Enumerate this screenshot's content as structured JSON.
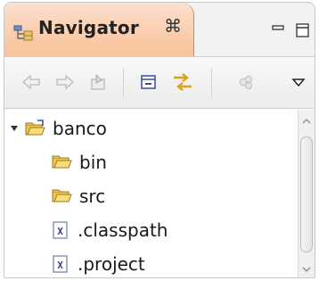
{
  "view": {
    "title": "Navigator",
    "close_glyph": "⌘",
    "tab_color": "#f9c9a6"
  },
  "toolbar": {
    "buttons": [
      {
        "name": "back-icon",
        "enabled": false
      },
      {
        "name": "forward-icon",
        "enabled": false
      },
      {
        "name": "go-into-icon",
        "enabled": false
      },
      {
        "name": "collapse-all-icon",
        "enabled": true
      },
      {
        "name": "link-with-editor-icon",
        "enabled": true
      },
      {
        "name": "filters-icon",
        "enabled": false
      },
      {
        "name": "view-menu-icon",
        "enabled": true
      }
    ]
  },
  "tree": {
    "root": {
      "label": "banco",
      "icon": "project-folder-icon",
      "expanded": true
    },
    "children": [
      {
        "label": "bin",
        "icon": "folder-icon"
      },
      {
        "label": "src",
        "icon": "folder-icon"
      },
      {
        "label": ".classpath",
        "icon": "xml-file-icon"
      },
      {
        "label": ".project",
        "icon": "xml-file-icon"
      }
    ]
  }
}
